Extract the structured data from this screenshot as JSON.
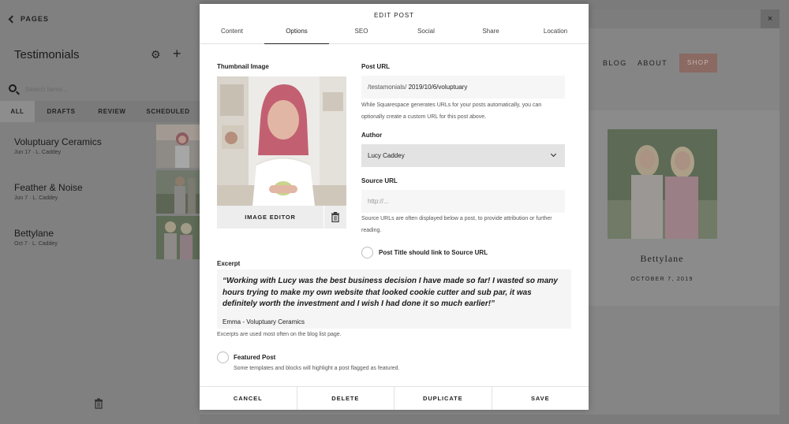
{
  "left_panel": {
    "back_label": "PAGES",
    "title": "Testimonials",
    "search_placeholder": "Search items...",
    "filter_tabs": [
      "ALL",
      "DRAFTS",
      "REVIEW",
      "SCHEDULED"
    ],
    "active_filter": "ALL",
    "posts": [
      {
        "title": "Voluptuary Ceramics",
        "meta": "Jun 17  ·  L. Caddey"
      },
      {
        "title": "Feather & Noise",
        "meta": "Jun 7  ·  L. Caddey"
      },
      {
        "title": "Bettylane",
        "meta": "Oct 7  ·  L. Caddey"
      }
    ]
  },
  "preview": {
    "nav": [
      "BLOG",
      "ABOUT"
    ],
    "shop_label": "SHOP",
    "post_title": "Bettylane",
    "post_date": "OCTOBER 7, 2019",
    "close_label": "×"
  },
  "modal": {
    "title": "EDIT POST",
    "tabs": [
      "Content",
      "Options",
      "SEO",
      "Social",
      "Share",
      "Location"
    ],
    "active_tab": "Options",
    "thumbnail_label": "Thumbnail Image",
    "image_editor_label": "IMAGE EDITOR",
    "post_url_label": "Post URL",
    "post_url_prefix": "/testamonials/",
    "post_url_value": "2019/10/6/voluptuary",
    "post_url_help": "While Squarespace generates URLs for your posts automatically, you can optionally create a custom URL for this post above.",
    "author_label": "Author",
    "author_value": "Lucy Caddey",
    "source_url_label": "Source URL",
    "source_url_placeholder": "http://...",
    "source_url_help": "Source URLs are often displayed below a post, to provide attribution or further reading.",
    "link_source_label": "Post Title should link to Source URL",
    "excerpt_label": "Excerpt",
    "excerpt_quote": "“Working with Lucy was the best business decision I have made so far! I wasted so many hours trying to make my own website that looked cookie cutter and sub par, it was definitely worth the investment and I wish I had done it so much earlier!”",
    "excerpt_attribution": "Emma - Voluptuary Ceramics",
    "excerpt_help": "Excerpts are used most often on the blog list page.",
    "featured_label": "Featured Post",
    "featured_help": "Some templates and blocks will highlight a post flagged as featured.",
    "footer": {
      "cancel": "CANCEL",
      "delete": "DELETE",
      "duplicate": "DUPLICATE",
      "save": "SAVE"
    }
  },
  "colors": {
    "overlay_gray": "#7b7b7b",
    "modal_bg": "#ffffff",
    "field_bg": "#f6f6f6",
    "select_bg": "#e3e3e3",
    "shop_button": "#8a6a63"
  }
}
